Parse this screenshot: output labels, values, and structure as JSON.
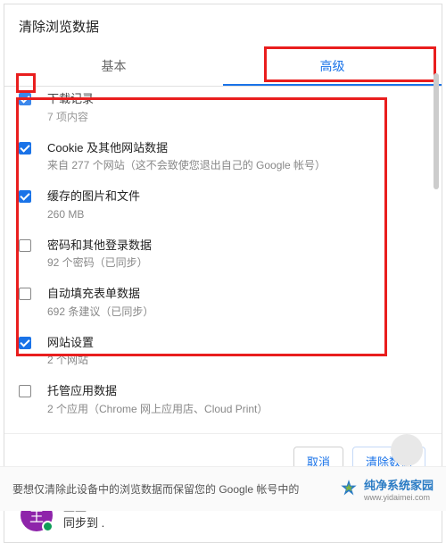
{
  "dialog": {
    "title": "清除浏览数据"
  },
  "tabs": {
    "basic": "基本",
    "advanced": "高级"
  },
  "items": [
    {
      "title": "下载记录",
      "sub": "7 项内容",
      "checked": true
    },
    {
      "title": "Cookie 及其他网站数据",
      "sub": "来自 277 个网站（这不会致使您退出自己的 Google 帐号）",
      "checked": true
    },
    {
      "title": "缓存的图片和文件",
      "sub": "260 MB",
      "checked": true
    },
    {
      "title": "密码和其他登录数据",
      "sub": "92 个密码（已同步）",
      "checked": false
    },
    {
      "title": "自动填充表单数据",
      "sub": "692 条建议（已同步）",
      "checked": false
    },
    {
      "title": "网站设置",
      "sub": "2 个网站",
      "checked": true
    },
    {
      "title": "托管应用数据",
      "sub": "2 个应用（Chrome 网上应用店、Cloud Print）",
      "checked": false
    }
  ],
  "buttons": {
    "cancel": "取消",
    "confirm": "清除数据"
  },
  "account": {
    "initial": "王",
    "name": "王王.",
    "sync": "同步到 ."
  },
  "footer": {
    "text": "要想仅清除此设备中的浏览数据而保留您的 Google 帐号中的",
    "brand": "纯净系统家园",
    "url": "www.yidaimei.com"
  }
}
